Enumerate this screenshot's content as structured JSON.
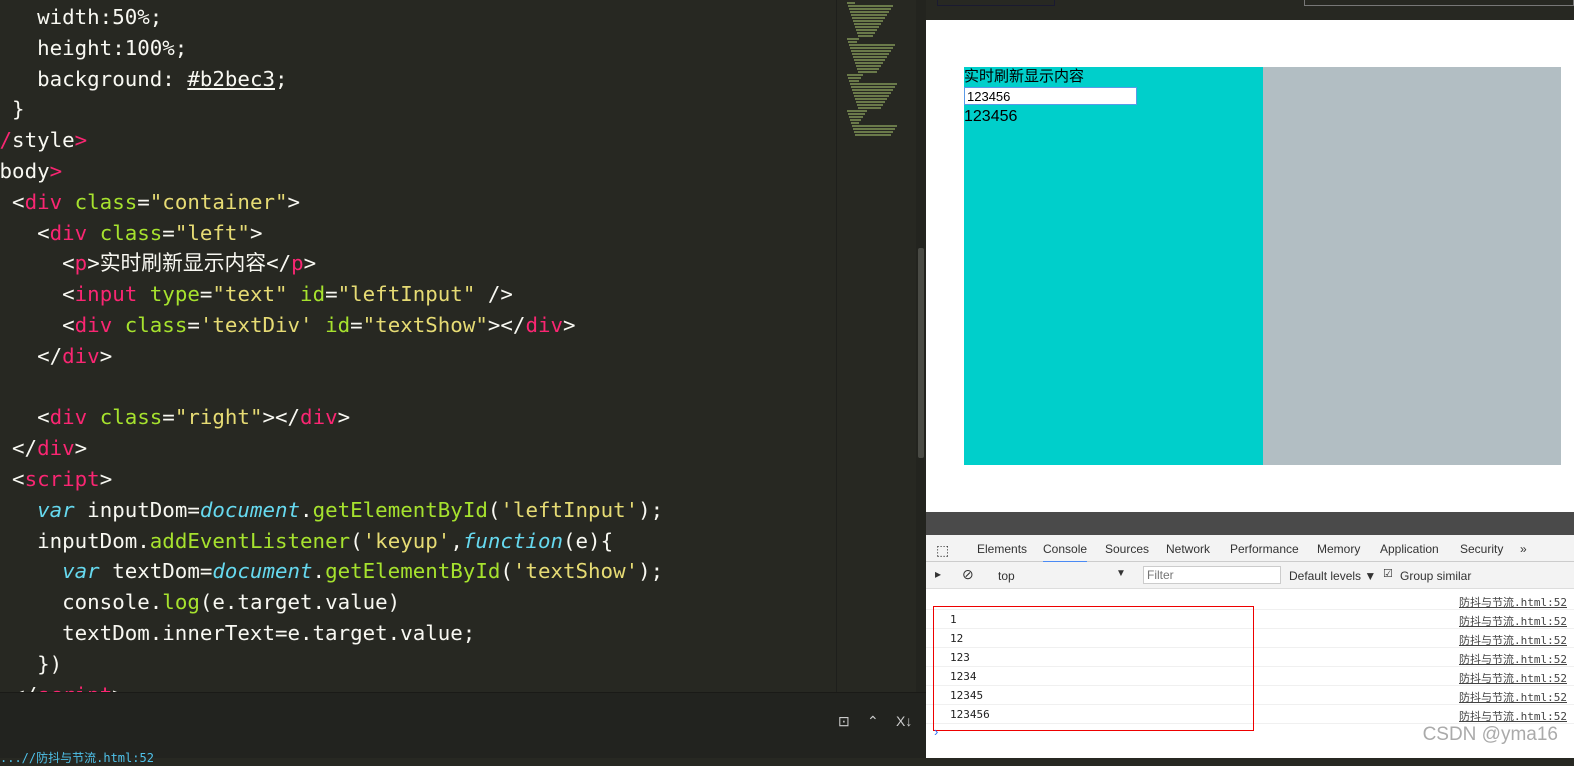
{
  "editor": {
    "lines": [
      [
        [
          "    width:50%;",
          ""
        ]
      ],
      [
        [
          "    height:100%;",
          ""
        ]
      ],
      [
        [
          "    background: ",
          ""
        ],
        [
          "#b2bec3",
          "u"
        ],
        [
          ";",
          ""
        ]
      ],
      [
        [
          "  }",
          ""
        ]
      ],
      [
        [
          "</",
          "t"
        ],
        [
          "style",
          ""
        ],
        [
          ">",
          "t"
        ]
      ],
      [
        [
          "<",
          "t"
        ],
        [
          "body",
          ""
        ],
        [
          ">",
          "t"
        ]
      ],
      [
        [
          "  <",
          "w"
        ],
        [
          "div",
          "t"
        ],
        [
          " class",
          "a"
        ],
        [
          "=",
          ""
        ],
        [
          "\"container\"",
          "s"
        ],
        [
          ">",
          ""
        ]
      ],
      [
        [
          "    <",
          ""
        ],
        [
          "div",
          "t"
        ],
        [
          " class",
          "a"
        ],
        [
          "=",
          ""
        ],
        [
          "\"left\"",
          "s"
        ],
        [
          ">",
          ""
        ]
      ],
      [
        [
          "      <",
          ""
        ],
        [
          "p",
          "t"
        ],
        [
          ">实时刷新显示内容</",
          ""
        ],
        [
          "p",
          "t"
        ],
        [
          ">",
          ""
        ]
      ],
      [
        [
          "      <",
          ""
        ],
        [
          "input",
          "t"
        ],
        [
          " type",
          "a"
        ],
        [
          "=",
          ""
        ],
        [
          "\"text\"",
          "s"
        ],
        [
          " id",
          "a"
        ],
        [
          "=",
          ""
        ],
        [
          "\"leftInput\"",
          "s"
        ],
        [
          " />",
          ""
        ]
      ],
      [
        [
          "      <",
          ""
        ],
        [
          "div",
          "t"
        ],
        [
          " class",
          "a"
        ],
        [
          "=",
          ""
        ],
        [
          "'textDiv'",
          "s"
        ],
        [
          " id",
          "a"
        ],
        [
          "=",
          ""
        ],
        [
          "\"textShow\"",
          "s"
        ],
        [
          "></",
          ""
        ],
        [
          "div",
          "t"
        ],
        [
          ">",
          ""
        ]
      ],
      [
        [
          "    </",
          ""
        ],
        [
          "div",
          "t"
        ],
        [
          ">",
          ""
        ]
      ],
      [
        [
          "",
          ""
        ]
      ],
      [
        [
          "    <",
          ""
        ],
        [
          "div",
          "t"
        ],
        [
          " class",
          "a"
        ],
        [
          "=",
          ""
        ],
        [
          "\"right\"",
          "s"
        ],
        [
          "></",
          ""
        ],
        [
          "div",
          "t"
        ],
        [
          ">",
          ""
        ]
      ],
      [
        [
          "  </",
          ""
        ],
        [
          "div",
          "t"
        ],
        [
          ">",
          ""
        ]
      ],
      [
        [
          "  <",
          ""
        ],
        [
          "script",
          "t"
        ],
        [
          ">",
          ""
        ]
      ],
      [
        [
          "    ",
          ""
        ],
        [
          "var",
          "k"
        ],
        [
          " inputDom=",
          ""
        ],
        [
          "document",
          "k"
        ],
        [
          ".",
          ""
        ],
        [
          "getElementById",
          "f"
        ],
        [
          "(",
          ""
        ],
        [
          "'leftInput'",
          "s"
        ],
        [
          ");",
          ""
        ]
      ],
      [
        [
          "    inputDom.",
          ""
        ],
        [
          "addEventListener",
          "f"
        ],
        [
          "(",
          ""
        ],
        [
          "'keyup'",
          "s"
        ],
        [
          ",",
          ""
        ],
        [
          "function",
          "k"
        ],
        [
          "(e){",
          ""
        ]
      ],
      [
        [
          "      ",
          ""
        ],
        [
          "var",
          "k"
        ],
        [
          " textDom=",
          ""
        ],
        [
          "document",
          "k"
        ],
        [
          ".",
          ""
        ],
        [
          "getElementById",
          "f"
        ],
        [
          "(",
          ""
        ],
        [
          "'textShow'",
          "s"
        ],
        [
          ");",
          ""
        ]
      ],
      [
        [
          "      console.",
          ""
        ],
        [
          "log",
          "f"
        ],
        [
          "(e.target.value)",
          ""
        ]
      ],
      [
        [
          "      textDom.innerText=e.target.value;",
          ""
        ]
      ],
      [
        [
          "    })",
          ""
        ]
      ],
      [
        [
          "  </",
          ""
        ],
        [
          "script",
          "t"
        ],
        [
          ">",
          ""
        ]
      ]
    ]
  },
  "panel": {
    "icons": [
      "terminal-icon",
      "chevron-up-icon",
      "close-sort-icon"
    ],
    "path": "...//防抖与节流.html:52"
  },
  "page": {
    "title": "实时刷新显示内容",
    "input_value": "123456",
    "text_show": "123456",
    "left_color": "#00cfcb",
    "right_color": "#b2bec3"
  },
  "devtools": {
    "tabs": [
      "Elements",
      "Console",
      "Sources",
      "Network",
      "Performance",
      "Memory",
      "Application",
      "Security",
      "»"
    ],
    "active_tab": "Console",
    "context": "top",
    "filter_placeholder": "Filter",
    "levels": "Default levels ▼",
    "group_similar": "Group similar",
    "group_similar_checked": true
  },
  "console": {
    "rows": [
      {
        "value": "",
        "source": "防抖与节流.html:52"
      },
      {
        "value": "1",
        "source": "防抖与节流.html:52"
      },
      {
        "value": "12",
        "source": "防抖与节流.html:52"
      },
      {
        "value": "123",
        "source": "防抖与节流.html:52"
      },
      {
        "value": "1234",
        "source": "防抖与节流.html:52"
      },
      {
        "value": "12345",
        "source": "防抖与节流.html:52"
      },
      {
        "value": "123456",
        "source": "防抖与节流.html:52"
      }
    ],
    "prompt": "›"
  },
  "watermark": "CSDN @yma16"
}
